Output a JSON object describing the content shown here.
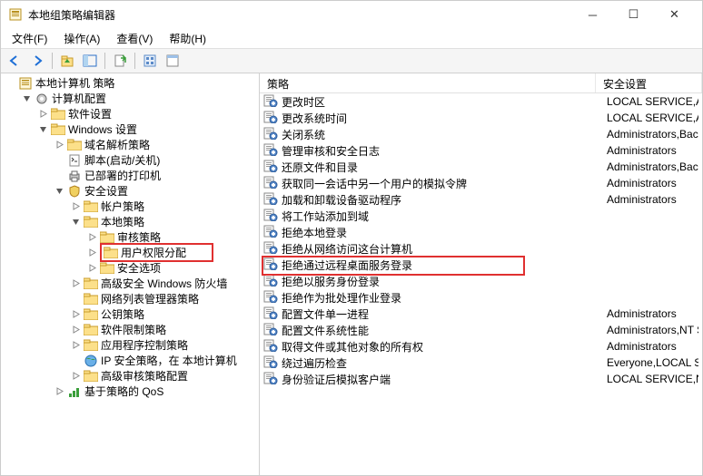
{
  "window": {
    "title": "本地组策略编辑器"
  },
  "menubar": {
    "file": "文件(F)",
    "action": "操作(A)",
    "view": "查看(V)",
    "help": "帮助(H)"
  },
  "toolbar_icons": {
    "back": "back-icon",
    "forward": "forward-icon",
    "up": "up-icon",
    "show_hide": "show-hide-icon",
    "export": "export-icon",
    "refresh": "refresh-icon",
    "help": "help-icon"
  },
  "tree": {
    "root": "本地计算机 策略",
    "computer_config": "计算机配置",
    "software_settings": "软件设置",
    "windows_settings": "Windows 设置",
    "name_resolution": "域名解析策略",
    "scripts": "脚本(启动/关机)",
    "deployed_printers": "已部署的打印机",
    "security_settings": "安全设置",
    "account_policies": "帐户策略",
    "local_policies": "本地策略",
    "audit_policy": "审核策略",
    "user_rights": "用户权限分配",
    "security_options": "安全选项",
    "windows_firewall": "高级安全 Windows 防火墙",
    "network_list": "网络列表管理器策略",
    "public_key": "公钥策略",
    "software_restriction": "软件限制策略",
    "app_control": "应用程序控制策略",
    "ip_security": "IP 安全策略，在 本地计算机",
    "advanced_audit": "高级审核策略配置",
    "policy_qos": "基于策略的 QoS"
  },
  "list_header": {
    "policy": "策略",
    "security_setting": "安全设置"
  },
  "policies": [
    {
      "name": "更改时区",
      "setting": "LOCAL SERVICE,Adm"
    },
    {
      "name": "更改系统时间",
      "setting": "LOCAL SERVICE,Adm"
    },
    {
      "name": "关闭系统",
      "setting": "Administrators,Backu"
    },
    {
      "name": "管理审核和安全日志",
      "setting": "Administrators"
    },
    {
      "name": "还原文件和目录",
      "setting": "Administrators,Backu"
    },
    {
      "name": "获取同一会话中另一个用户的模拟令牌",
      "setting": "Administrators"
    },
    {
      "name": "加载和卸载设备驱动程序",
      "setting": "Administrators"
    },
    {
      "name": "将工作站添加到域",
      "setting": ""
    },
    {
      "name": "拒绝本地登录",
      "setting": ""
    },
    {
      "name": "拒绝从网络访问这台计算机",
      "setting": ""
    },
    {
      "name": "拒绝通过远程桌面服务登录",
      "setting": "",
      "highlight": true
    },
    {
      "name": "拒绝以服务身份登录",
      "setting": ""
    },
    {
      "name": "拒绝作为批处理作业登录",
      "setting": ""
    },
    {
      "name": "配置文件单一进程",
      "setting": "Administrators"
    },
    {
      "name": "配置文件系统性能",
      "setting": "Administrators,NT SE"
    },
    {
      "name": "取得文件或其他对象的所有权",
      "setting": "Administrators"
    },
    {
      "name": "绕过遍历检查",
      "setting": "Everyone,LOCAL SER"
    },
    {
      "name": "身份验证后模拟客户端",
      "setting": "LOCAL SERVICE,NET."
    }
  ]
}
